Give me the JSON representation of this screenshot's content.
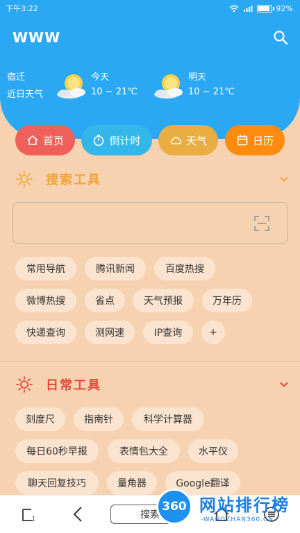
{
  "status": {
    "time": "下午3:22",
    "battery": "92%",
    "battery_level": 0.92
  },
  "header": {
    "title": "WWW"
  },
  "weather": {
    "city": "宿迁",
    "city_sub": "近日天气",
    "today_label": "今天",
    "today_temp": "10 ~ 21℃",
    "tomorrow_label": "明天",
    "tomorrow_temp": "10 ~ 21℃"
  },
  "tabs": [
    {
      "label": "首页",
      "color": "#f0605a"
    },
    {
      "label": "倒计时",
      "color": "#33b7ea"
    },
    {
      "label": "天气",
      "color": "#e9ad43"
    },
    {
      "label": "日历",
      "color": "#ff8c0f"
    }
  ],
  "search_tools": {
    "title": "搜索工具",
    "color": "#f1a53a",
    "chips": [
      "常用导航",
      "腾讯新闻",
      "百度热搜",
      "微博热搜",
      "省点",
      "天气预报",
      "万年历",
      "快递查询",
      "测网速",
      "IP查询",
      "+"
    ]
  },
  "daily_tools": {
    "title": "日常工具",
    "color": "#e8453a",
    "chips": [
      "刻度尺",
      "指南针",
      "科学计算器",
      "每日60秒早报",
      "表情包大全",
      "水平仪",
      "聊天回复技巧",
      "量角器",
      "Google翻译"
    ]
  },
  "bottom_bar": {
    "search_label": "搜索"
  },
  "watermark": {
    "badge": "360",
    "text": "网站排行榜",
    "sub": "-WANGZHAN360.CN-"
  }
}
